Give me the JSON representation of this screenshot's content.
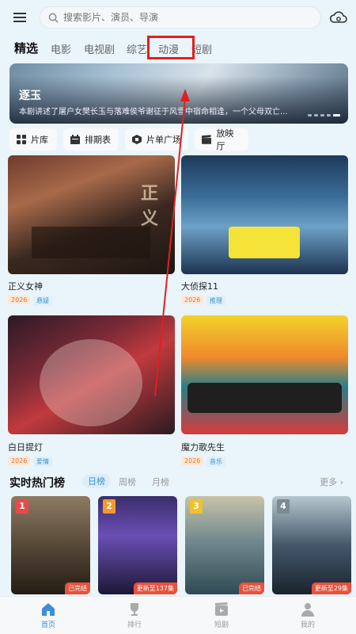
{
  "search": {
    "placeholder": "搜索影片、演员、导演"
  },
  "tabs": [
    {
      "label": "精选",
      "active": true
    },
    {
      "label": "电影"
    },
    {
      "label": "电视剧"
    },
    {
      "label": "综艺"
    },
    {
      "label": "动漫"
    },
    {
      "label": "短剧"
    }
  ],
  "banner": {
    "title": "逐玉",
    "description": "本剧讲述了屠户女樊长玉与落难侯爷谢征于风雪中宿命相逢，一个父母双亡..."
  },
  "quick_links": [
    {
      "label": "片库",
      "icon": "film-library-icon"
    },
    {
      "label": "排期表",
      "icon": "calendar-icon"
    },
    {
      "label": "片单广场",
      "icon": "playlist-icon"
    },
    {
      "label": "放映厅",
      "icon": "clapper-icon"
    }
  ],
  "posters": [
    {
      "title": "正义女神",
      "year": "2026",
      "genre": "悬疑"
    },
    {
      "title": "大侦探11",
      "year": "2026",
      "genre": "推理"
    },
    {
      "title": "白日提灯",
      "year": "2026",
      "genre": "爱情"
    },
    {
      "title": "魔力歌先生",
      "year": "2026",
      "genre": "音乐"
    }
  ],
  "hot": {
    "title": "实时热门榜",
    "tabs": [
      "日榜",
      "周榜",
      "月榜"
    ],
    "more": "更多",
    "items": [
      {
        "rank": "1",
        "status": "已完结"
      },
      {
        "rank": "2",
        "status": "更新至137集"
      },
      {
        "rank": "3",
        "status": "已完结"
      },
      {
        "rank": "4",
        "status": "更新至29集"
      }
    ]
  },
  "nav": [
    {
      "label": "首页",
      "icon": "home-icon",
      "active": true
    },
    {
      "label": "排行",
      "icon": "trophy-icon"
    },
    {
      "label": "短剧",
      "icon": "short-video-icon"
    },
    {
      "label": "我的",
      "icon": "profile-icon"
    }
  ],
  "colors": {
    "accent": "#3a8fd6",
    "highlight": "#e02020",
    "year_tag": "#e6752b",
    "genre_tag": "#3a95c9"
  }
}
